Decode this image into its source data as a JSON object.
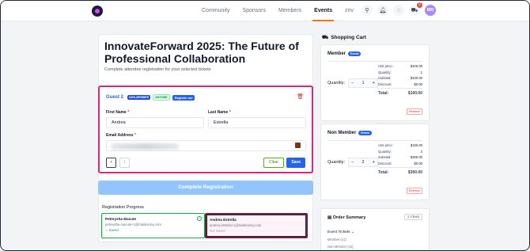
{
  "nav": {
    "links": [
      "Community",
      "Sponsors",
      "Members",
      "Events",
      "znv"
    ],
    "active": "Events",
    "cart_count": "0",
    "avatar_initials": "MR",
    "colors": {
      "accent": "#f97316",
      "logo": "#d946ef"
    }
  },
  "page": {
    "title": "InnovateForward 2025: The Future of Professional Collaboration",
    "subtitle": "Complete attendee registration for your selected tickets"
  },
  "guest": {
    "title": "Guest 2",
    "badges": [
      "NON-MEMBER",
      "ANYONE"
    ],
    "register_label": "Register me",
    "first_name_label": "First Name",
    "first_name_value": "Andrea",
    "last_name_label": "Last Name",
    "last_name_value": "Estrella",
    "email_label": "Email Address",
    "prev_label": "‹",
    "next_label": "›",
    "clear_label": "Clear",
    "save_label": "Save"
  },
  "complete_label": "Complete Registration",
  "progress": {
    "title": "Registration Progress",
    "cards": [
      {
        "name": "Petreysha Macute",
        "email": "petreysha.macute+1@mailsoniny.com",
        "status": "✓ Saved"
      },
      {
        "name": "Andrea Estrella",
        "email": "andrea.estrella+1@mailsoniny.com",
        "status": "Not Saved"
      }
    ]
  },
  "cart": {
    "title": "Shopping Cart",
    "event_pill": "Event",
    "qty_label": "Quantity:",
    "remove_label": "Remove",
    "items": [
      {
        "name": "Member",
        "qty": "1",
        "unit_price": "$100.00",
        "quantity": "1",
        "subtotal": "$100.00",
        "discount": "$0.00",
        "total": "$100.00"
      },
      {
        "name": "Non Member",
        "qty": "2",
        "unit_price": "$150.00",
        "quantity": "2",
        "subtotal": "$300.00",
        "discount": "$0.00",
        "total": "$300.00"
      }
    ],
    "line_labels": {
      "unit_price": "Unit price:",
      "quantity": "Quantity:",
      "subtotal": "Subtotal:",
      "discount": "Discount:",
      "total": "Total:"
    }
  },
  "order_summary": {
    "title": "Order Summary",
    "count": "2 ITEMS",
    "section": "Event Tickets",
    "items": [
      "Member (x1)",
      "Non Member (x2)"
    ]
  }
}
